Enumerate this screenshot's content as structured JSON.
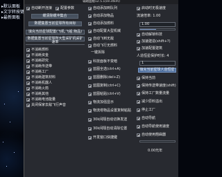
{
  "sidebar": {
    "items": [
      "默认面板",
      "文字转按键",
      "最新面板"
    ]
  },
  "window": {
    "title": "辅助面板v2.5.1(en.stkm)"
  },
  "col1": {
    "cb_auto_disconnect": "自动断开连接",
    "cb_config_params": "配置参数",
    "btn_cache": "缓清除缓冲集合",
    "btn_fetch_data": "数据集置当前星球所有目标",
    "btn_fill_planets": "填充当前星球配置(飞机,飞船,物品)",
    "btn_set_miner": "数据集置当前星球所大型采矿机采矿速率",
    "items": [
      "不消耗燃料",
      "不消耗资金",
      "不消耗研究",
      "不消耗传送带",
      "不消耗工厂",
      "不消耗建筑材料",
      "不消耗机器人",
      "不消耗火箭",
      "不消耗其他",
      "不消耗电池能量",
      "关闭保家去敌飞行声音"
    ]
  },
  "col2": {
    "items": [
      "自动添加到队列",
      "自动添加物品",
      "自动添加燃料",
      "自动配置大型机械",
      "自动飞到无敌",
      "自动飞行无燃料"
    ],
    "one_click": "一键拆除",
    "cb_science": "科技面板不变暗",
    "hotkeys": [
      "蓝图全选(ctrl+A)",
      "蓝图删除(del+Z)",
      "蓝图复制(ctrl+C)",
      "蓝图粘贴(ctrl+V)",
      "物流加强显示",
      "物流塔物品设置复制粘贴",
      "30k间隔自动切换发送",
      "30k间隔自动清除位置",
      "开发窗口快捷键"
    ]
  },
  "col3": {
    "cb_auto_stack": "启动时无极速度",
    "speed_label": "流速倍率: 1.00",
    "speed_value": "1.00",
    "cb_mod1": "自动解锁科技",
    "cb_mod2": "加速建造(shift+?)",
    "cb_mod3": "加速配置建筑",
    "entry_label": "人造恒星保护时长: 4",
    "entry_value": "1",
    "btn_blueprint": "填充当前星球人造恒星",
    "cb_prot1": "保持当前",
    "cb_prot2": "保持传送带速度(shift)",
    "cb_prot3": "保持工厂数量流量",
    "cb_prot4": "减少原料溢出",
    "cb_prot5": "停止工厂",
    "cb_prot6": "自动导航",
    "cb_prot7": "自动导航使用速度",
    "cb_prot8": "自动使用翘曲器",
    "warp_value": "0.00光年"
  }
}
